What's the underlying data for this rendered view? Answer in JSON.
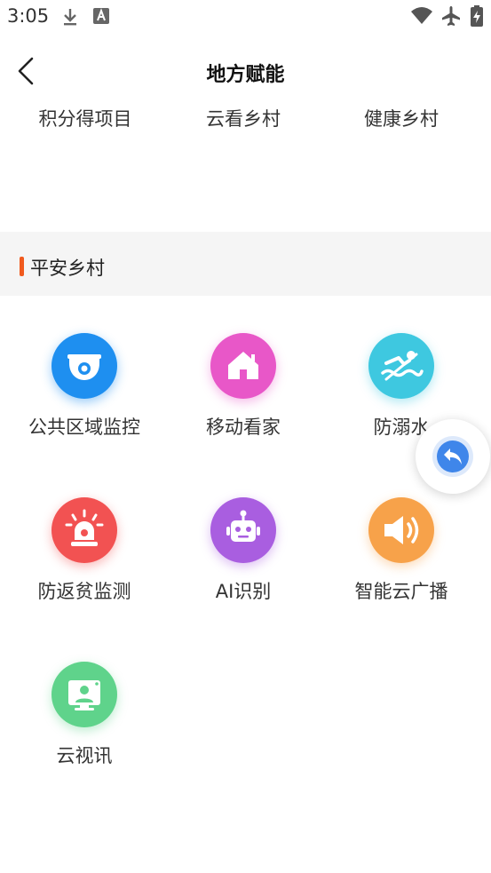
{
  "status_bar": {
    "time": "3:05",
    "icons": [
      "download-icon",
      "font-a-icon",
      "wifi-icon",
      "airplane-mode-icon",
      "battery-charging-icon"
    ]
  },
  "nav": {
    "back_icon": "chevron-left-icon",
    "title": "地方赋能"
  },
  "top_links": [
    {
      "label": "积分得项目"
    },
    {
      "label": "云看乡村"
    },
    {
      "label": "健康乡村"
    }
  ],
  "section": {
    "title": "平安乡村",
    "accent": "#f05a1e",
    "items": [
      {
        "label": "公共区域监控",
        "icon": "surveillance-camera-icon",
        "color": "#1e8ff0"
      },
      {
        "label": "移动看家",
        "icon": "home-icon",
        "color": "#e857c8"
      },
      {
        "label": "防溺水",
        "icon": "swimmer-icon",
        "color": "#3ec8e0"
      },
      {
        "label": "防返贫监测",
        "icon": "alarm-light-icon",
        "color": "#f25252"
      },
      {
        "label": "AI识别",
        "icon": "robot-icon",
        "color": "#a95ee0"
      },
      {
        "label": "智能云广播",
        "icon": "speaker-icon",
        "color": "#f7a24a"
      },
      {
        "label": "云视讯",
        "icon": "video-call-icon",
        "color": "#5fd38b"
      }
    ]
  },
  "float_button": {
    "icon": "reply-arrow-icon",
    "color": "#3f86ea"
  }
}
